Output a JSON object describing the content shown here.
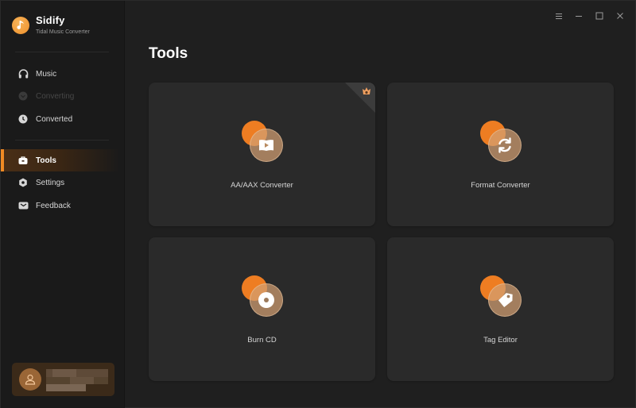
{
  "app": {
    "name": "Sidify",
    "subtitle": "Tidal Music Converter",
    "accent_color": "#f08a24"
  },
  "sidebar": {
    "items": [
      {
        "label": "Music",
        "icon": "headphones-icon",
        "state": "normal"
      },
      {
        "label": "Converting",
        "icon": "converting-icon",
        "state": "disabled"
      },
      {
        "label": "Converted",
        "icon": "clock-icon",
        "state": "normal"
      },
      {
        "label": "Tools",
        "icon": "toolbox-icon",
        "state": "active"
      },
      {
        "label": "Settings",
        "icon": "gear-icon",
        "state": "normal"
      },
      {
        "label": "Feedback",
        "icon": "mail-icon",
        "state": "normal"
      }
    ],
    "user": {
      "avatar_icon": "user-icon",
      "name": "(blurred)"
    }
  },
  "window_controls": {
    "menu": "menu-icon",
    "minimize": "minimize-icon",
    "maximize": "maximize-icon",
    "close": "close-icon"
  },
  "main": {
    "title": "Tools",
    "tools": [
      {
        "label": "AA/AAX Converter",
        "icon": "audiobook-play-icon",
        "badge": "premium-crown-icon"
      },
      {
        "label": "Format Converter",
        "icon": "refresh-icon"
      },
      {
        "label": "Burn CD",
        "icon": "disc-icon"
      },
      {
        "label": "Tag Editor",
        "icon": "tag-icon"
      }
    ]
  }
}
